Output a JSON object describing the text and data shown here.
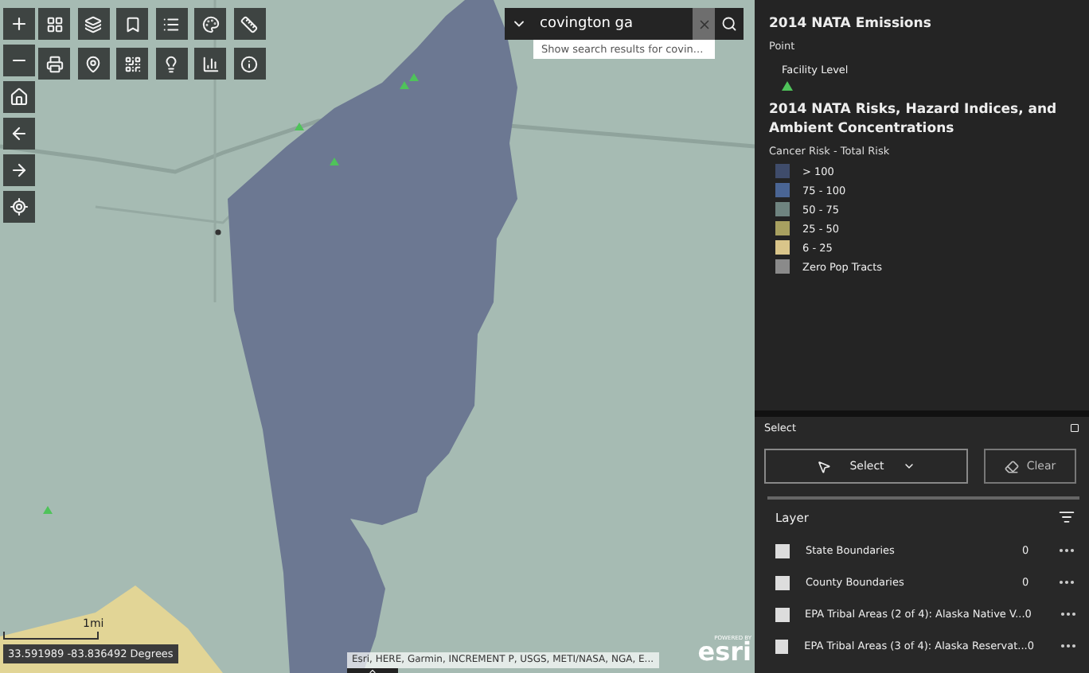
{
  "map": {
    "search": {
      "value": "covington ga",
      "suggestion": "Show search results for covin..."
    },
    "coordinates": "33.591989 -83.836492 Degrees",
    "scale": "1mi",
    "attribution": "Esri, HERE, Garmin, INCREMENT P, USGS, METI/NASA, NGA, E...",
    "logo": {
      "caption": "POWERED BY",
      "name": "esri"
    }
  },
  "legend": {
    "layers": [
      {
        "title": "2014 NATA Emissions",
        "subtitle": "Point",
        "items": [
          {
            "kind": "point",
            "label": "Facility Level",
            "color": "#4fc35a"
          }
        ]
      },
      {
        "title": "2014 NATA Risks, Hazard Indices, and Ambient Concentrations",
        "subtitle": "Cancer Risk - Total Risk",
        "items": [
          {
            "kind": "swatch",
            "label": "> 100",
            "color": "#3f4c6b"
          },
          {
            "kind": "swatch",
            "label": "75 - 100",
            "color": "#4a6594"
          },
          {
            "kind": "swatch",
            "label": "50 - 75",
            "color": "#6f8480"
          },
          {
            "kind": "swatch",
            "label": "25 - 50",
            "color": "#a8a060"
          },
          {
            "kind": "swatch",
            "label": "6 - 25",
            "color": "#d9c58a"
          },
          {
            "kind": "swatch",
            "label": "Zero Pop Tracts",
            "color": "#8a8a8a"
          }
        ]
      }
    ]
  },
  "select": {
    "title": "Select",
    "select_button": "Select",
    "clear_button": "Clear",
    "layer_header": "Layer",
    "layers": [
      {
        "label": "State Boundaries",
        "count": "0",
        "checked": false
      },
      {
        "label": "County Boundaries",
        "count": "0",
        "checked": false
      },
      {
        "label": "EPA Tribal Areas (2 of 4): Alaska Native V...",
        "count": "0",
        "checked": false
      },
      {
        "label": "EPA Tribal Areas (3 of 4): Alaska Reservat...",
        "count": "0",
        "checked": false
      }
    ]
  }
}
